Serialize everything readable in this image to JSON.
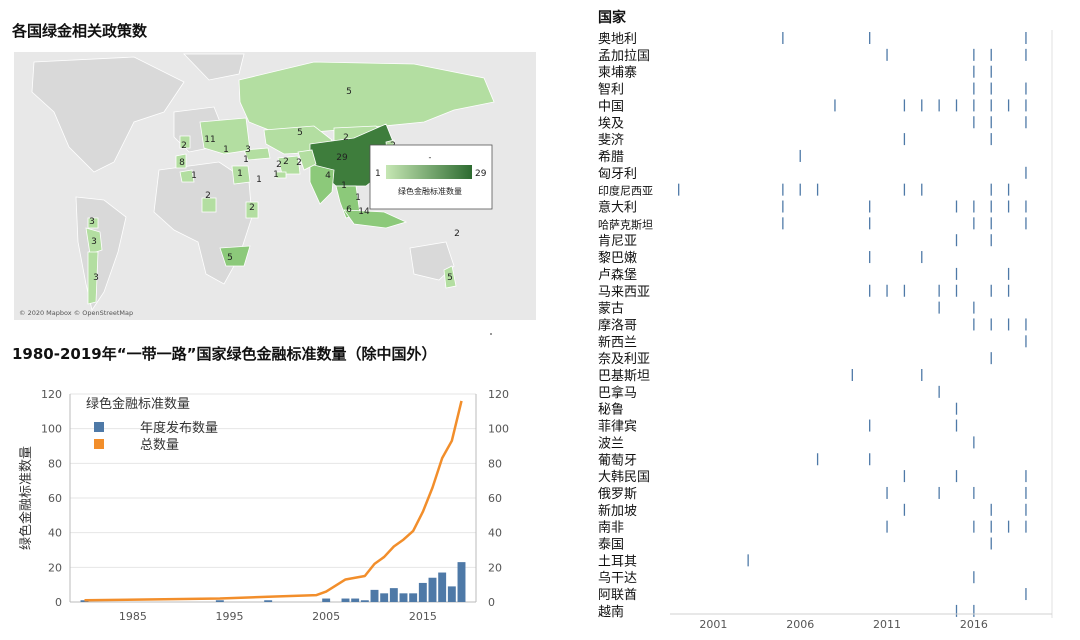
{
  "map_panel": {
    "title": "各国绿金相关政策数",
    "attribution": "© 2020 Mapbox © OpenStreetMap",
    "legend": {
      "dash": "-",
      "min": "1",
      "max": "29",
      "label": "绿色金融标准数量",
      "color_min": "#c6e7b4",
      "color_max": "#2d6b30"
    },
    "country_counts": [
      {
        "label": "5",
        "region": "Russia"
      },
      {
        "label": "5",
        "region": "Kazakhstan"
      },
      {
        "label": "2",
        "region": "Mongolia"
      },
      {
        "label": "29",
        "region": "China"
      },
      {
        "label": "2",
        "region": "Pakistan"
      },
      {
        "label": "4",
        "region": "India"
      },
      {
        "label": "1",
        "region": "Bangladesh"
      },
      {
        "label": "1",
        "region": "Myanmar"
      },
      {
        "label": "6",
        "region": "Malaysia"
      },
      {
        "label": "14",
        "region": "Indonesia"
      },
      {
        "label": "2",
        "region": "Philippines"
      },
      {
        "label": "2",
        "region": "South Korea"
      },
      {
        "label": "2",
        "region": "Iran"
      },
      {
        "label": "1",
        "region": "Turkey"
      },
      {
        "label": "3",
        "region": "Greece"
      },
      {
        "label": "11",
        "region": "Europe"
      },
      {
        "label": "1",
        "region": "Poland"
      },
      {
        "label": "2",
        "region": "UK"
      },
      {
        "label": "8",
        "region": "Portugal"
      },
      {
        "label": "1",
        "region": "Egypt"
      },
      {
        "label": "2",
        "region": "Nigeria"
      },
      {
        "label": "1",
        "region": "Uganda"
      },
      {
        "label": "2",
        "region": "Kenya"
      },
      {
        "label": "5",
        "region": "South Africa"
      },
      {
        "label": "1",
        "region": "Morocco"
      },
      {
        "label": "3",
        "region": "Panama"
      },
      {
        "label": "3",
        "region": "Peru"
      },
      {
        "label": "3",
        "region": "Chile"
      },
      {
        "label": "2",
        "region": "Fiji"
      },
      {
        "label": "5",
        "region": "New Zealand"
      },
      {
        "label": "1",
        "region": "Lebanon"
      },
      {
        "label": "2",
        "region": "UAE"
      }
    ]
  },
  "chart_data": [
    {
      "type": "bar+line",
      "title": "1980-2019年“一带一路”国家绿色金融标准数量（除中国外）",
      "legend_title": "绿色金融标准数量",
      "series": [
        {
          "name": "年度发布数量",
          "color": "#4e79a7",
          "axis": "left"
        },
        {
          "name": "总数量",
          "color": "#f28e2b",
          "axis": "right"
        }
      ],
      "ylabel": "绿色金融标准数量",
      "ylim_left": [
        0,
        120
      ],
      "ylim_right": [
        0,
        120
      ],
      "yticks": [
        0,
        20,
        40,
        60,
        80,
        100,
        120
      ],
      "xticks": [
        1985,
        1995,
        2005,
        2015
      ],
      "xlim": [
        1978.5,
        2020.5
      ],
      "bars": [
        {
          "x": 1980,
          "y": 1
        },
        {
          "x": 1994,
          "y": 1
        },
        {
          "x": 1999,
          "y": 1
        },
        {
          "x": 2005,
          "y": 2
        },
        {
          "x": 2007,
          "y": 2
        },
        {
          "x": 2008,
          "y": 2
        },
        {
          "x": 2009,
          "y": 1
        },
        {
          "x": 2010,
          "y": 7
        },
        {
          "x": 2011,
          "y": 5
        },
        {
          "x": 2012,
          "y": 8
        },
        {
          "x": 2013,
          "y": 5
        },
        {
          "x": 2014,
          "y": 5
        },
        {
          "x": 2015,
          "y": 11
        },
        {
          "x": 2016,
          "y": 14
        },
        {
          "x": 2017,
          "y": 17
        },
        {
          "x": 2018,
          "y": 9
        },
        {
          "x": 2019,
          "y": 23
        }
      ],
      "cumulative": [
        {
          "x": 1980,
          "y": 1
        },
        {
          "x": 1994,
          "y": 2
        },
        {
          "x": 1999,
          "y": 3
        },
        {
          "x": 2004,
          "y": 4
        },
        {
          "x": 2005,
          "y": 6
        },
        {
          "x": 2007,
          "y": 13
        },
        {
          "x": 2009,
          "y": 15
        },
        {
          "x": 2010,
          "y": 22
        },
        {
          "x": 2011,
          "y": 26
        },
        {
          "x": 2012,
          "y": 32
        },
        {
          "x": 2013,
          "y": 36
        },
        {
          "x": 2014,
          "y": 41
        },
        {
          "x": 2015,
          "y": 52
        },
        {
          "x": 2016,
          "y": 66
        },
        {
          "x": 2017,
          "y": 83
        },
        {
          "x": 2018,
          "y": 93
        },
        {
          "x": 2019,
          "y": 116
        }
      ]
    },
    {
      "type": "scatter",
      "subtype": "timeline-ticks",
      "header": "国家",
      "x_ticks": [
        2001,
        2006,
        2011,
        2016
      ],
      "xlim": [
        1998.5,
        2020.5
      ],
      "tick_color": "#4e79a7",
      "countries": [
        {
          "name": "奥地利",
          "years": [
            2005,
            2010,
            2019
          ]
        },
        {
          "name": "孟加拉国",
          "years": [
            2011,
            2016,
            2017,
            2019
          ]
        },
        {
          "name": "柬埔寨",
          "years": [
            2016,
            2017
          ]
        },
        {
          "name": "智利",
          "years": [
            2016,
            2017,
            2019
          ]
        },
        {
          "name": "中国",
          "years": [
            2008,
            2012,
            2013,
            2014,
            2015,
            2016,
            2017,
            2018,
            2019
          ]
        },
        {
          "name": "埃及",
          "years": [
            2016,
            2017,
            2019
          ]
        },
        {
          "name": "斐济",
          "years": [
            2012,
            2017
          ]
        },
        {
          "name": "希腊",
          "years": [
            2006
          ]
        },
        {
          "name": "匈牙利",
          "years": [
            2019
          ]
        },
        {
          "name": "印度尼西亚",
          "years": [
            1999,
            2005,
            2006,
            2007,
            2012,
            2013,
            2017,
            2018
          ]
        },
        {
          "name": "意大利",
          "years": [
            2005,
            2010,
            2015,
            2016,
            2017,
            2018,
            2019
          ]
        },
        {
          "name": "哈萨克斯坦",
          "years": [
            2005,
            2010,
            2016,
            2017,
            2019
          ]
        },
        {
          "name": "肯尼亚",
          "years": [
            2015,
            2017
          ]
        },
        {
          "name": "黎巴嫩",
          "years": [
            2010,
            2013
          ]
        },
        {
          "name": "卢森堡",
          "years": [
            2015,
            2018
          ]
        },
        {
          "name": "马来西亚",
          "years": [
            2010,
            2011,
            2012,
            2014,
            2015,
            2017,
            2018
          ]
        },
        {
          "name": "蒙古",
          "years": [
            2014,
            2016
          ]
        },
        {
          "name": "摩洛哥",
          "years": [
            2016,
            2017,
            2018,
            2019
          ]
        },
        {
          "name": "新西兰",
          "years": [
            2019
          ]
        },
        {
          "name": "奈及利亚",
          "years": [
            2017
          ]
        },
        {
          "name": "巴基斯坦",
          "years": [
            2009,
            2013
          ]
        },
        {
          "name": "巴拿马",
          "years": [
            2014
          ]
        },
        {
          "name": "秘鲁",
          "years": [
            2015
          ]
        },
        {
          "name": "菲律宾",
          "years": [
            2010,
            2015
          ]
        },
        {
          "name": "波兰",
          "years": [
            2016
          ]
        },
        {
          "name": "葡萄牙",
          "years": [
            2007,
            2010
          ]
        },
        {
          "name": "大韩民国",
          "years": [
            2012,
            2015,
            2019
          ]
        },
        {
          "name": "俄罗斯",
          "years": [
            2011,
            2014,
            2016,
            2019
          ]
        },
        {
          "name": "新加坡",
          "years": [
            2012,
            2017,
            2019
          ]
        },
        {
          "name": "南非",
          "years": [
            2011,
            2016,
            2017,
            2018,
            2019
          ]
        },
        {
          "name": "泰国",
          "years": [
            2017
          ]
        },
        {
          "name": "土耳其",
          "years": [
            2003
          ]
        },
        {
          "name": "乌干达",
          "years": [
            2016
          ]
        },
        {
          "name": "阿联酋",
          "years": [
            2019
          ]
        },
        {
          "name": "越南",
          "years": [
            2015,
            2016
          ]
        }
      ]
    }
  ]
}
